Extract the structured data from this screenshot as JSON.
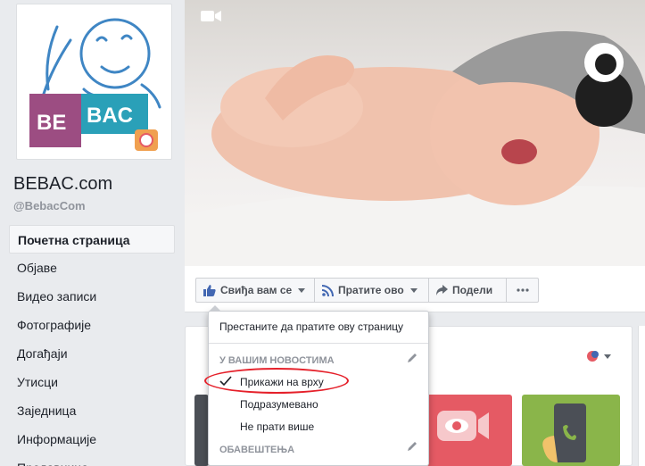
{
  "sidebar": {
    "page_name": "BEBAC.com",
    "page_handle": "@BebacCom",
    "logo_text": "BEBAC",
    "nav": [
      {
        "label": "Почетна страница",
        "active": true
      },
      {
        "label": "Објаве"
      },
      {
        "label": "Видео записи"
      },
      {
        "label": "Фотографије"
      },
      {
        "label": "Догађаји"
      },
      {
        "label": "Утисци"
      },
      {
        "label": "Заједница"
      },
      {
        "label": "Информације"
      },
      {
        "label": "Продавница"
      }
    ]
  },
  "actions": {
    "like_label": "Свиђа вам се",
    "follow_label": "Пратите ово",
    "share_label": "Подели"
  },
  "follow_menu": {
    "unfollow": "Престаните да пратите ову страницу",
    "news_header": "У ВАШИМ НОВОСТИМА",
    "options": [
      "Прикажи на врху",
      "Подразумевано",
      "Не прати више"
    ],
    "selected_option": "Прикажи на врху",
    "notifications_header": "ОБАВЕШТЕЊА"
  },
  "colors": {
    "accent": "#4267b2",
    "highlight_circle": "#e5202a",
    "logo_purple": "#9c4d82",
    "logo_teal": "#2aa0b8"
  }
}
